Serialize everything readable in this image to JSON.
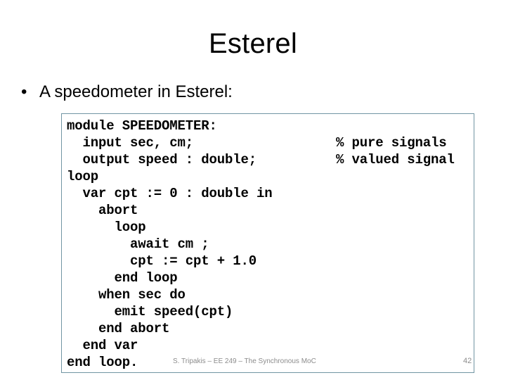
{
  "slide": {
    "title": "Esterel",
    "bullet": {
      "marker": "•",
      "text": "A speedometer in Esterel:"
    },
    "code_box": {
      "border_color": "#7195a3",
      "background_color": "#ffffff",
      "lines": [
        {
          "code": "module SPEEDOMETER:",
          "comment": ""
        },
        {
          "code": "  input sec, cm;",
          "comment": "% pure signals"
        },
        {
          "code": "  output speed : double;",
          "comment": "% valued signal"
        },
        {
          "code": "loop",
          "comment": ""
        },
        {
          "code": "  var cpt := 0 : double in",
          "comment": ""
        },
        {
          "code": "    abort",
          "comment": ""
        },
        {
          "code": "      loop",
          "comment": ""
        },
        {
          "code": "        await cm ;",
          "comment": ""
        },
        {
          "code": "        cpt := cpt + 1.0",
          "comment": ""
        },
        {
          "code": "      end loop",
          "comment": ""
        },
        {
          "code": "    when sec do",
          "comment": ""
        },
        {
          "code": "      emit speed(cpt)",
          "comment": ""
        },
        {
          "code": "    end abort",
          "comment": ""
        },
        {
          "code": "  end var",
          "comment": ""
        },
        {
          "code": "end loop.",
          "comment": ""
        }
      ]
    },
    "footer": {
      "credit": "S. Tripakis – EE 249 – The Synchronous MoC",
      "page_number": "42",
      "text_color": "#8c8c8c"
    }
  }
}
